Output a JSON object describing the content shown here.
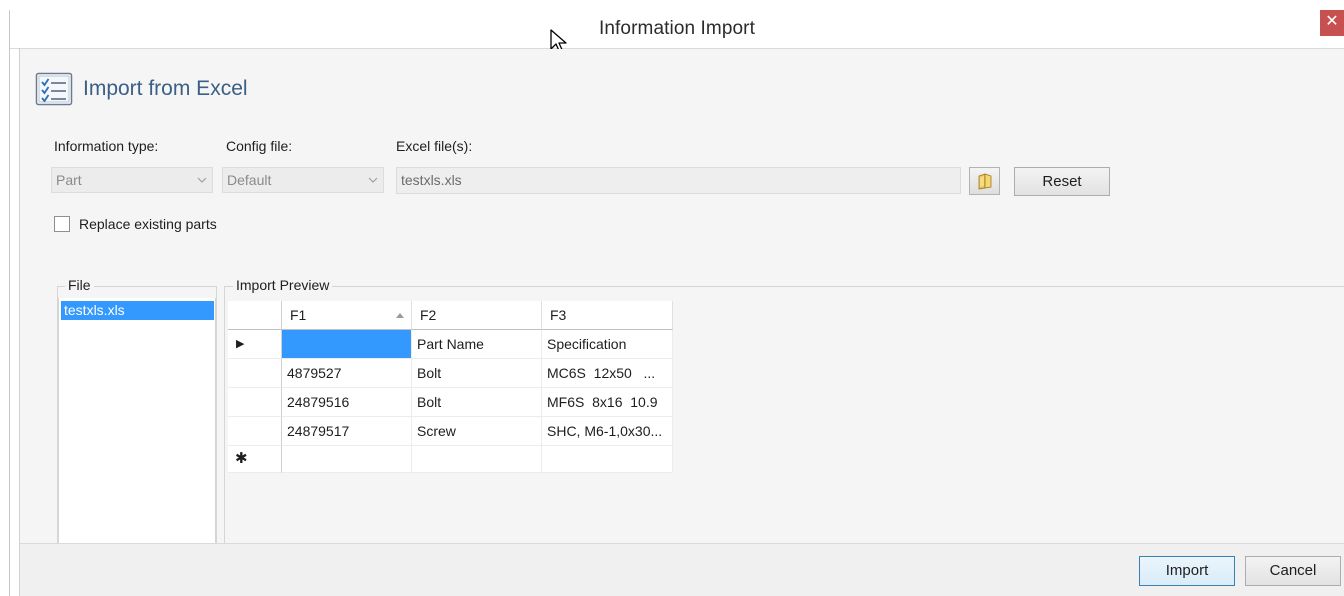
{
  "window": {
    "title": "Information Import",
    "close_glyph": "✕"
  },
  "header": {
    "icon": "checklist-icon",
    "title": "Import from Excel"
  },
  "fields": {
    "info_type": {
      "label": "Information type:",
      "value": "Part"
    },
    "config_file": {
      "label": "Config file:",
      "value": "Default"
    },
    "excel_files": {
      "label": "Excel file(s):",
      "value": "testxls.xls"
    }
  },
  "buttons": {
    "browse_icon": "folder-icon",
    "reset": "Reset",
    "import": "Import",
    "cancel": "Cancel"
  },
  "options": {
    "replace_existing": {
      "label": "Replace existing parts",
      "checked": false
    }
  },
  "file_panel": {
    "legend": "File",
    "items": [
      "testxls.xls"
    ]
  },
  "preview_panel": {
    "legend": "Import Preview",
    "columns": [
      "F1",
      "F2",
      "F3"
    ],
    "sorted_column": "F1",
    "rows": [
      [
        "",
        "Part Name",
        "Specification"
      ],
      [
        "4879527",
        "Bolt",
        "MC6S  12x50   ..."
      ],
      [
        "24879516",
        "Bolt",
        "MF6S  8x16  10.9"
      ],
      [
        "24879517",
        "Screw",
        "SHC, M6-1,0x30..."
      ]
    ],
    "current_row_glyph": "▶",
    "new_row_glyph": "✱"
  },
  "colors": {
    "accent": "#3399ff",
    "header_title": "#3b5f86",
    "close": "#c75050"
  }
}
